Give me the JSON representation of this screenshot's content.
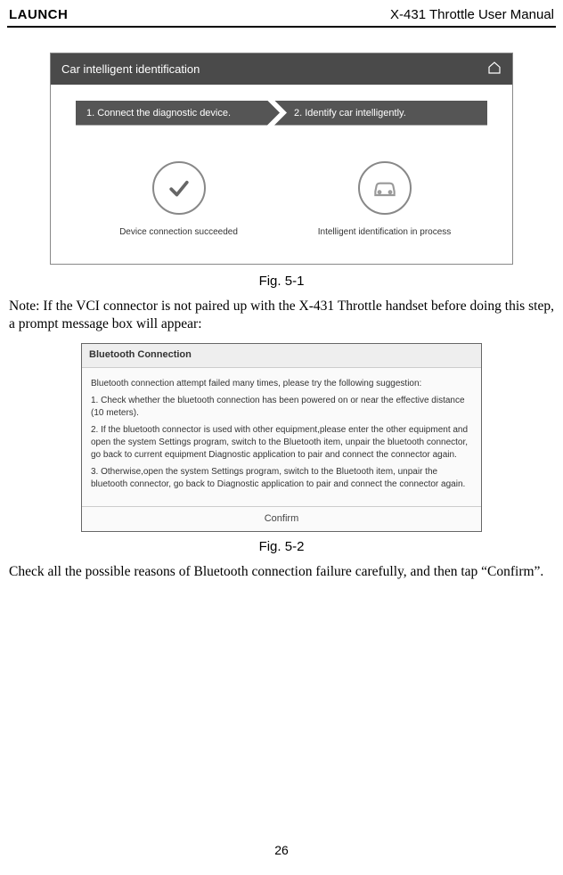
{
  "header": {
    "left": "LAUNCH",
    "right": "X-431 Throttle User Manual"
  },
  "fig1": {
    "titlebar": "Car intelligent identification",
    "step1": "1. Connect the diagnostic device.",
    "step2": "2. Identify car intelligently.",
    "label1": "Device connection succeeded",
    "label2": "Intelligent identification in process",
    "caption": "Fig. 5-1"
  },
  "para1": "Note: If the VCI connector is not paired up with the X-431 Throttle handset before doing this step, a prompt message box will appear:",
  "fig2": {
    "title": "Bluetooth Connection",
    "intro": "Bluetooth connection attempt failed many times, please try the following suggestion:",
    "item1": "1. Check whether the bluetooth connection has been powered on or near the effective distance (10 meters).",
    "item2": "2. If the bluetooth connector is used with other equipment,please enter the other equipment and open the system Settings program, switch to the Bluetooth item, unpair the bluetooth connector, go back to current equipment Diagnostic application to pair and connect the connector again.",
    "item3": "3. Otherwise,open the system Settings program, switch to the Bluetooth item, unpair the bluetooth connector, go back to Diagnostic application to pair and connect the connector again.",
    "confirm": "Confirm",
    "caption": "Fig. 5-2"
  },
  "para2": "Check all the possible reasons of Bluetooth connection failure carefully, and then tap “Confirm”.",
  "page_number": "26"
}
